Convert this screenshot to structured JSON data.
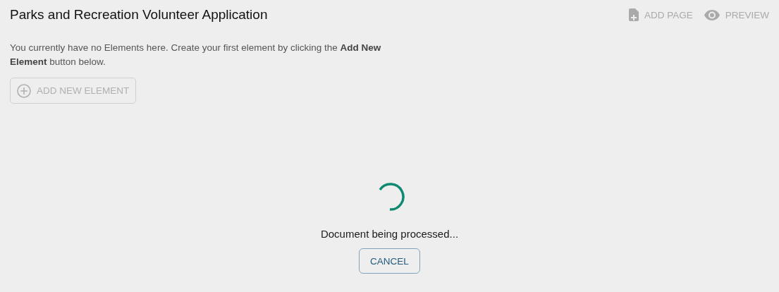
{
  "header": {
    "title": "Parks and Recreation Volunteer Application",
    "actions": [
      {
        "kind": "add-page",
        "label": "ADD PAGE",
        "disabled": true
      },
      {
        "kind": "preview",
        "label": "PREVIEW",
        "disabled": true
      }
    ]
  },
  "empty_state": {
    "message": "You currently have no Elements here. Create your first element by clicking the **Add New Element** button below.",
    "button": {
      "label": "ADD NEW ELEMENT",
      "disabled": true
    }
  },
  "processing": {
    "message": "Document being processed...",
    "cancel": "CANCEL"
  }
}
